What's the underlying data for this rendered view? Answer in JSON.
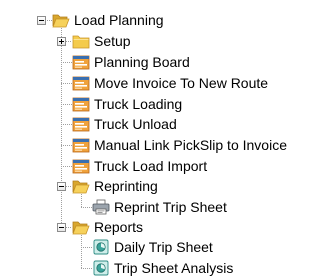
{
  "tree": {
    "root": {
      "label": "Load Planning",
      "icon": "folder-open-icon",
      "state": "expanded",
      "children": [
        {
          "label": "Setup",
          "icon": "folder-closed-icon",
          "state": "collapsed"
        },
        {
          "label": "Planning Board",
          "icon": "form-icon"
        },
        {
          "label": "Move Invoice To New Route",
          "icon": "form-icon"
        },
        {
          "label": "Truck Loading",
          "icon": "form-icon"
        },
        {
          "label": "Truck Unload",
          "icon": "form-icon"
        },
        {
          "label": "Manual Link PickSlip to Invoice",
          "icon": "form-icon"
        },
        {
          "label": "Truck Load Import",
          "icon": "form-icon"
        },
        {
          "label": "Reprinting",
          "icon": "folder-open-icon",
          "state": "expanded",
          "children": [
            {
              "label": "Reprint Trip Sheet",
              "icon": "printer-icon"
            }
          ]
        },
        {
          "label": "Reports",
          "icon": "folder-open-icon",
          "state": "expanded",
          "children": [
            {
              "label": "Daily Trip Sheet",
              "icon": "report-icon"
            },
            {
              "label": "Trip Sheet Analysis",
              "icon": "report-icon"
            }
          ]
        }
      ]
    }
  },
  "colors": {
    "folder": "#f2c23a",
    "folder_dark": "#c8952a",
    "form_orange": "#e58a1e",
    "form_blue": "#3a6fb0",
    "tree_line": "#a0a0a0",
    "report_teal": "#3aa39a"
  }
}
